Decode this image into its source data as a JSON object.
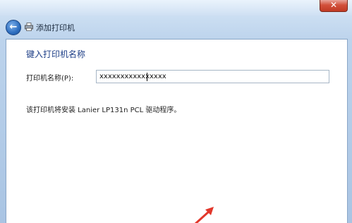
{
  "window": {
    "close_glyph": "✕"
  },
  "nav": {
    "back_glyph": "←",
    "title": "添加打印机",
    "printer_icon": "printer-icon"
  },
  "main": {
    "heading": "键入打印机名称",
    "name_label": "打印机名称(P):",
    "name_value": "xxxxxxxxxxxxxxxx",
    "driver_text": "该打印机将安装 Lanier LP131n PCL 驱动程序。"
  },
  "colors": {
    "heading": "#1e3f87",
    "annotation_arrow": "#e2372b"
  }
}
